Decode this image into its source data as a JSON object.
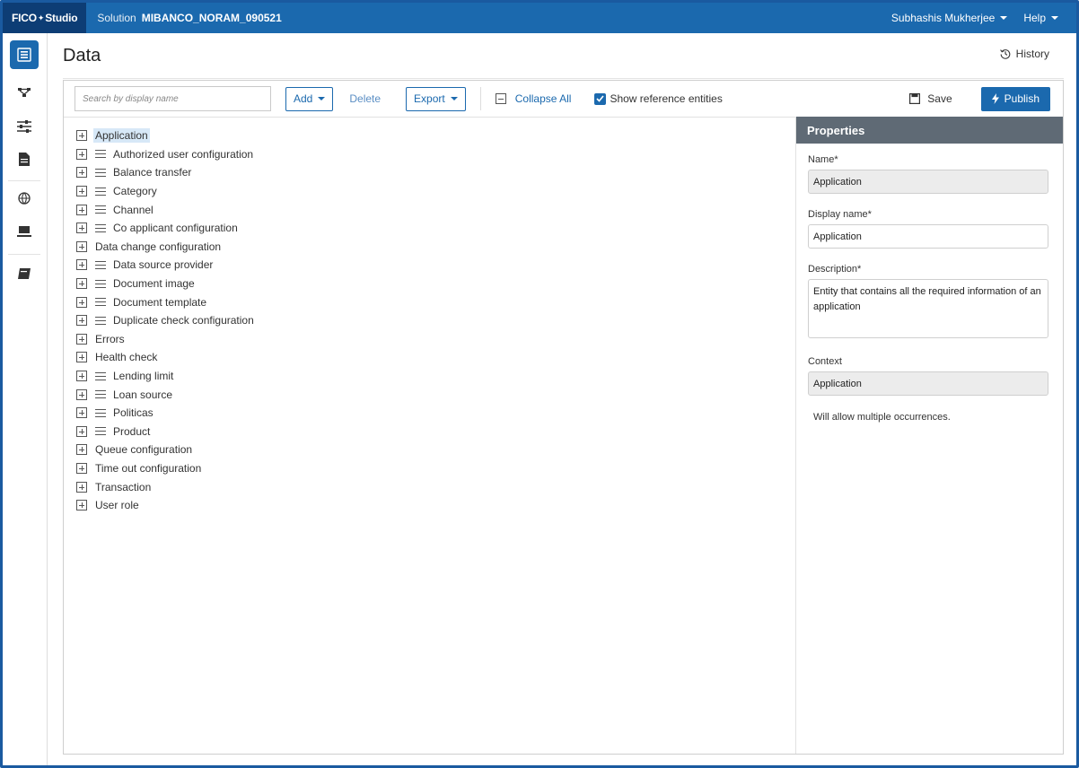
{
  "topbar": {
    "brand_left": "FICO",
    "brand_star": "✦",
    "brand_right": "Studio",
    "solution_label": "Solution",
    "solution_value": "MIBANCO_NORAM_090521",
    "user": "Subhashis Mukherjee",
    "help": "Help"
  },
  "rail": {
    "items": [
      {
        "icon": "data-entities-icon",
        "active": true
      },
      {
        "icon": "flow-icon"
      },
      {
        "icon": "sliders-icon"
      },
      {
        "icon": "document-icon"
      },
      {
        "icon": "globe-icon"
      },
      {
        "icon": "deploy-icon"
      },
      {
        "icon": "book-icon"
      }
    ]
  },
  "page": {
    "title": "Data",
    "history_label": "History"
  },
  "toolbar": {
    "search_placeholder": "Search by display name",
    "add_label": "Add",
    "delete_label": "Delete",
    "export_label": "Export",
    "collapse_label": "Collapse All",
    "show_ref_label": "Show reference entities",
    "show_ref_checked": true,
    "save_label": "Save",
    "publish_label": "Publish"
  },
  "tree": [
    {
      "label": "Application",
      "ref": false,
      "selected": true
    },
    {
      "label": "Authorized user configuration",
      "ref": true
    },
    {
      "label": "Balance transfer",
      "ref": true
    },
    {
      "label": "Category",
      "ref": true
    },
    {
      "label": "Channel",
      "ref": true
    },
    {
      "label": "Co applicant configuration",
      "ref": true
    },
    {
      "label": "Data change configuration",
      "ref": false
    },
    {
      "label": "Data source provider",
      "ref": true
    },
    {
      "label": "Document image",
      "ref": true
    },
    {
      "label": "Document template",
      "ref": true
    },
    {
      "label": "Duplicate check configuration",
      "ref": true
    },
    {
      "label": "Errors",
      "ref": false
    },
    {
      "label": "Health check",
      "ref": false
    },
    {
      "label": "Lending limit",
      "ref": true
    },
    {
      "label": "Loan source",
      "ref": true
    },
    {
      "label": "Politicas",
      "ref": true
    },
    {
      "label": "Product",
      "ref": true
    },
    {
      "label": "Queue configuration",
      "ref": false
    },
    {
      "label": "Time out configuration",
      "ref": false
    },
    {
      "label": "Transaction",
      "ref": false
    },
    {
      "label": "User role",
      "ref": false
    }
  ],
  "properties": {
    "header": "Properties",
    "name_label": "Name*",
    "name_value": "Application",
    "display_name_label": "Display name*",
    "display_name_value": "Application",
    "description_label": "Description*",
    "description_value": "Entity that contains all the required information of an application",
    "context_label": "Context",
    "context_value": "Application",
    "note": "Will allow multiple occurrences."
  },
  "colors": {
    "topbar": "#1b69ae",
    "brand": "#0d3d75",
    "accent": "#1b69ae",
    "props_header": "#5f6a75"
  }
}
